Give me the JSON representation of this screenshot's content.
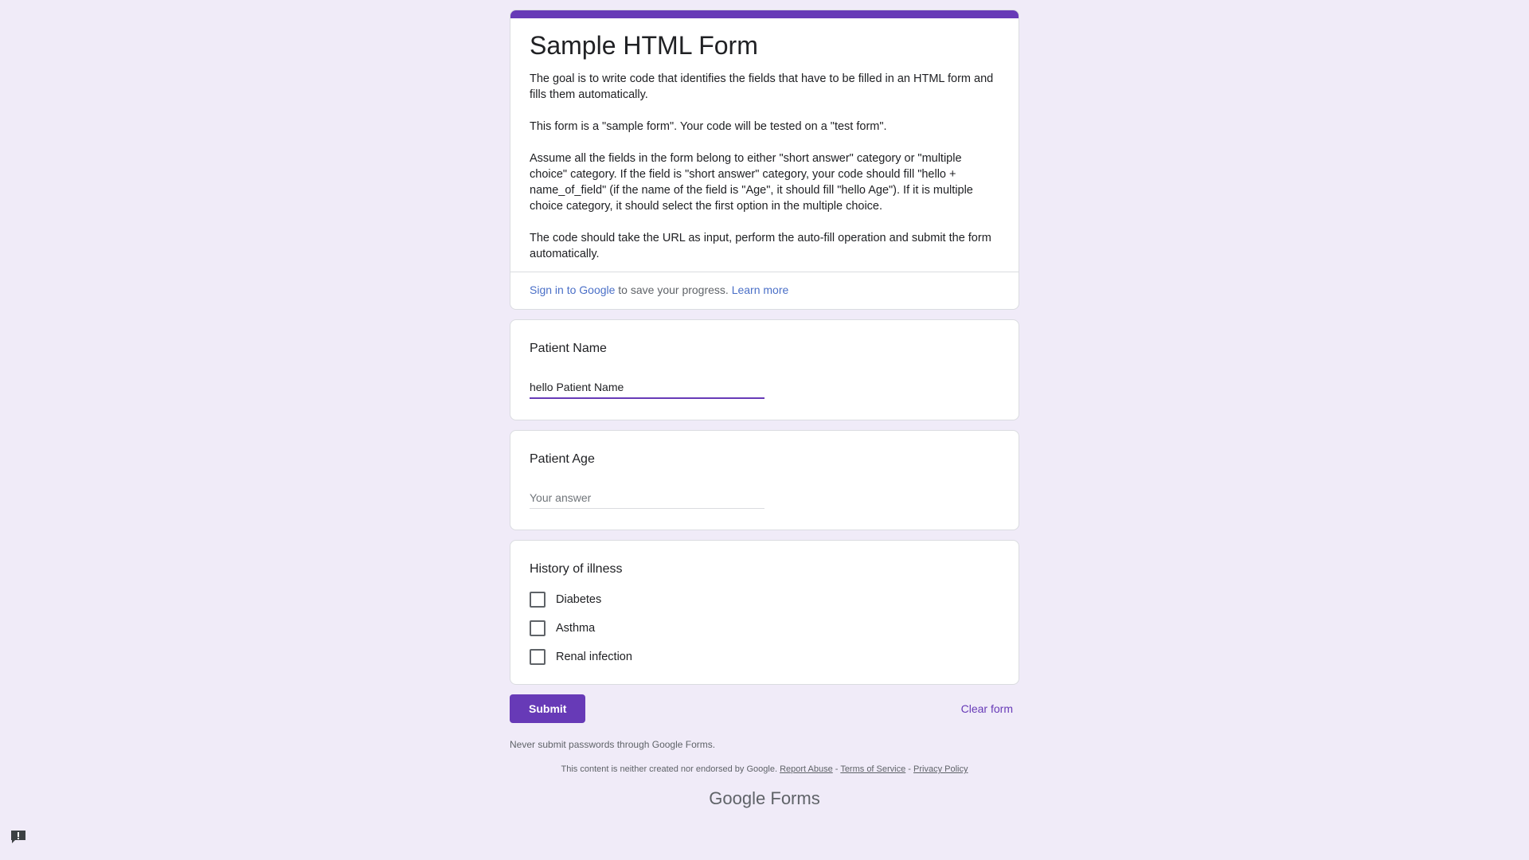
{
  "form": {
    "title": "Sample HTML Form",
    "description": [
      "The goal is to write code that identifies the fields that have to be filled in an HTML form and fills them automatically.",
      "This form is a \"sample form\". Your code will be tested on a \"test form\".",
      "Assume all the fields in the form belong to either \"short answer\" category or \"multiple choice\" category. If the field is \"short answer\" category, your code should fill \"hello + name_of_field\" (if the name of the field is \"Age\", it should fill \"hello Age\"). If it is multiple choice category, it should select the first option in the multiple choice.",
      "The code should take the URL as input, perform the auto-fill operation and submit the form automatically."
    ],
    "signin": {
      "link": "Sign in to Google",
      "middle": " to save your progress. ",
      "learn_more": "Learn more"
    },
    "accent_color": "#673ab7",
    "background_color": "#f0ebf8"
  },
  "questions": [
    {
      "title": "Patient Name",
      "value": "hello Patient Name",
      "placeholder": "Your answer"
    },
    {
      "title": "Patient Age",
      "value": "",
      "placeholder": "Your answer"
    },
    {
      "title": "History of illness",
      "options": [
        "Diabetes",
        "Asthma",
        "Renal infection"
      ],
      "checked": [
        false,
        false,
        false
      ]
    }
  ],
  "actions": {
    "submit_label": "Submit",
    "clear_label": "Clear form"
  },
  "footer": {
    "never_submit": "Never submit passwords through Google Forms.",
    "disclaimer_text": "This content is neither created nor endorsed by Google.",
    "report_abuse": "Report Abuse",
    "terms": "Terms of Service",
    "privacy": "Privacy Policy",
    "separator": " - ",
    "brand_google": "Google",
    "brand_forms": "Forms"
  },
  "icons": {
    "feedback": "feedback-icon"
  }
}
